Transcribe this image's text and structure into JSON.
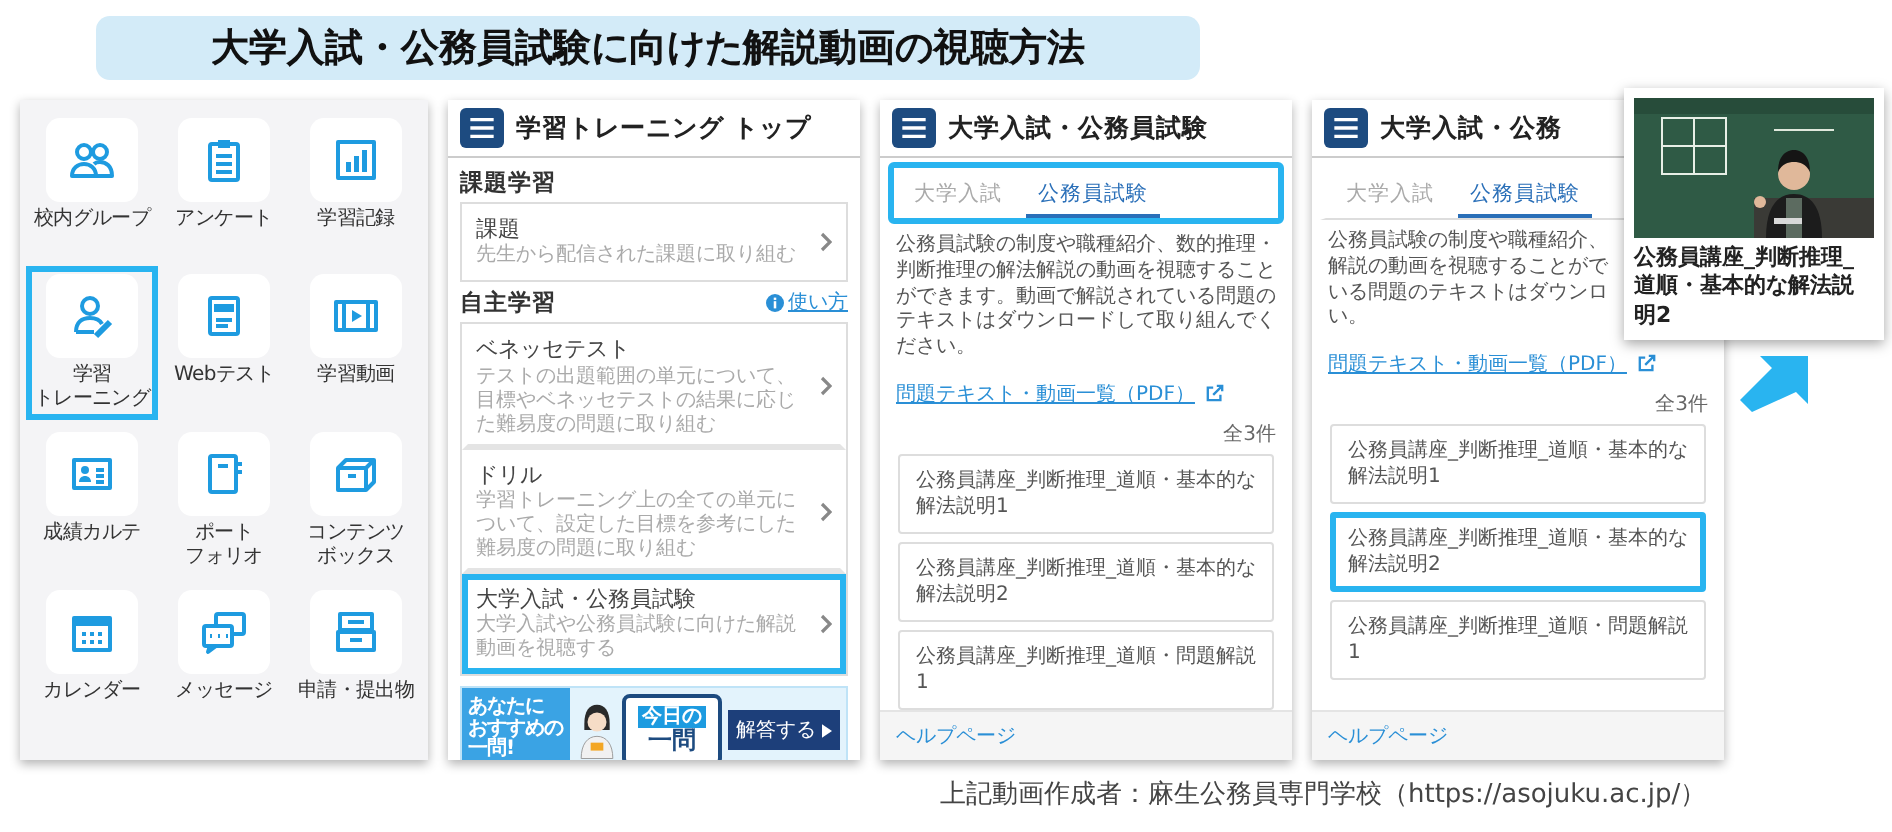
{
  "title": "大学入試・公務員試験に向けた解説動画の視聴方法",
  "home_panel": {
    "tiles": [
      {
        "label_lines": [
          "校内グループ"
        ],
        "highlighted": false
      },
      {
        "label_lines": [
          "アンケート"
        ],
        "highlighted": false
      },
      {
        "label_lines": [
          "学習記録"
        ],
        "highlighted": false
      },
      {
        "label_lines": [
          "学習",
          "トレーニング"
        ],
        "highlighted": true
      },
      {
        "label_lines": [
          "Webテスト"
        ],
        "highlighted": false
      },
      {
        "label_lines": [
          "学習動画"
        ],
        "highlighted": false
      },
      {
        "label_lines": [
          "成績カルテ"
        ],
        "highlighted": false
      },
      {
        "label_lines": [
          "ポート",
          "フォリオ"
        ],
        "highlighted": false
      },
      {
        "label_lines": [
          "コンテンツ",
          "ボックス"
        ],
        "highlighted": false
      },
      {
        "label_lines": [
          "カレンダー"
        ],
        "highlighted": false
      },
      {
        "label_lines": [
          "メッセージ"
        ],
        "highlighted": false
      },
      {
        "label_lines": [
          "申請・提出物"
        ],
        "highlighted": false
      }
    ]
  },
  "training_panel": {
    "title": "学習トレーニング トップ",
    "sections": [
      {
        "heading": "課題学習",
        "items": [
          {
            "title": "課題",
            "description": "先生から配信された課題に取り組む",
            "highlighted": false
          }
        ]
      },
      {
        "heading": "自主学習",
        "help_link": "使い方",
        "items": [
          {
            "title": "ベネッセテスト",
            "description": "テストの出題範囲の単元について、目標やベネッセテストの結果に応じた難易度の問題に取り組む",
            "highlighted": false
          },
          {
            "title": "ドリル",
            "description": "学習トレーニング上の全ての単元について、設定した目標を参考にした難易度の問題に取り組む",
            "highlighted": false
          },
          {
            "title": "大学入試・公務員試験",
            "description": "大学入試や公務員試験に向けた解説動画を視聴する",
            "highlighted": true
          }
        ]
      }
    ],
    "banner": {
      "tagline_lines": [
        "あなたに",
        "おすすめの",
        "一問!"
      ],
      "book_top": "今日の",
      "book_main": "一問",
      "button": "解答する"
    }
  },
  "exam_panels": [
    {
      "title": "大学入試・公務員試験",
      "tabs": [
        {
          "label": "大学入試",
          "selected": false
        },
        {
          "label": "公務員試験",
          "selected": true
        }
      ],
      "tabs_highlighted": true,
      "description": "公務員試験の制度や職種紹介、数的推理・判断推理の解法解説の動画を視聴することができます。動画で解説されている問題のテキストはダウンロードして取り組んでください。",
      "pdf_link": "問題テキスト・動画一覧（PDF）",
      "count": "全3件",
      "videos": [
        {
          "title": "公務員講座_判断推理_道順・基本的な解法説明1",
          "highlighted": false
        },
        {
          "title": "公務員講座_判断推理_道順・基本的な解法説明2",
          "highlighted": false
        },
        {
          "title": "公務員講座_判断推理_道順・問題解説 1",
          "highlighted": false
        }
      ],
      "help": "ヘルプページ"
    },
    {
      "title": "大学入試・公務",
      "tabs": [
        {
          "label": "大学入試",
          "selected": false
        },
        {
          "label": "公務員試験",
          "selected": true
        }
      ],
      "tabs_highlighted": false,
      "description_lines": [
        "公務員試験の制度や職種紹介、",
        "解説の動画を視聴することがで",
        "いる問題のテキストはダウンロ",
        "い。"
      ],
      "pdf_link": "問題テキスト・動画一覧（PDF）",
      "count": "全3件",
      "videos": [
        {
          "title": "公務員講座_判断推理_道順・基本的な解法説明1",
          "highlighted": false
        },
        {
          "title": "公務員講座_判断推理_道順・基本的な解法説明2",
          "highlighted": true
        },
        {
          "title": "公務員講座_判断推理_道順・問題解説 1",
          "highlighted": false
        }
      ],
      "help": "ヘルプページ"
    }
  ],
  "video_popup": {
    "title": "公務員講座_判断推理_道順・基本的な解法説明2"
  },
  "credit": "上記動画作成者：麻生公務員専門学校（https://asojuku.ac.jp/）"
}
